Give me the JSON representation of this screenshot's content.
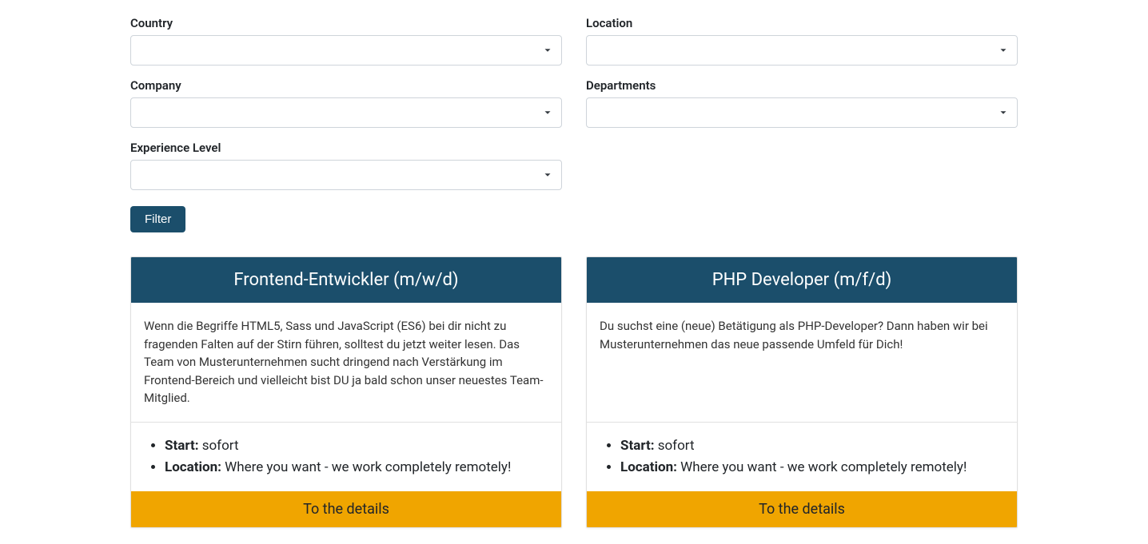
{
  "filters": {
    "country_label": "Country",
    "location_label": "Location",
    "company_label": "Company",
    "departments_label": "Departments",
    "experience_label": "Experience Level",
    "filter_button": "Filter"
  },
  "jobs": [
    {
      "title": "Frontend-Entwickler (m/w/d)",
      "description": "Wenn die Begriffe HTML5, Sass und JavaScript (ES6) bei dir nicht zu fragenden Falten auf der Stirn führen, solltest du jetzt weiter lesen. Das Team von Musterunternehmen sucht dringend nach Verstärkung im Frontend-Bereich und vielleicht bist DU ja bald schon unser neuestes Team-Mitglied.",
      "start_label": "Start:",
      "start_value": " sofort",
      "location_label": "Location:",
      "location_value": " Where you want - we work completely remotely!",
      "details_link": "To the details"
    },
    {
      "title": "PHP Developer (m/f/d)",
      "description": "Du suchst eine (neue) Betätigung als PHP-Developer? Dann haben wir bei Musterunternehmen das neue passende Umfeld für Dich!",
      "start_label": "Start:",
      "start_value": " sofort",
      "location_label": "Location:",
      "location_value": " Where you want - we work completely remotely!",
      "details_link": "To the details"
    }
  ]
}
